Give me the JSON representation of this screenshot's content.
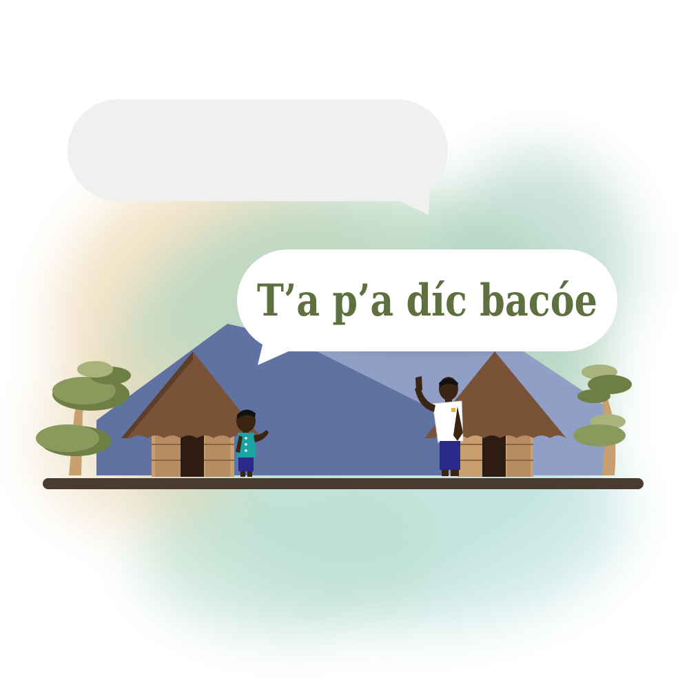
{
  "speech": {
    "upper_bubble_text": "",
    "lower_bubble_text": "T’a p’a díc bacóe"
  },
  "colors": {
    "text_green": "#5f7040",
    "bubble_upper": "#f0f0f0",
    "bubble_lower": "#ffffff",
    "mountain_back": "#8f9fc6",
    "mountain_front": "#5f72a2",
    "roof": "#7a5238",
    "hut_wall": "#c8a070",
    "ground": "#4a3a30",
    "tree_dark": "#6e7f45",
    "tree_light": "#a8b47c"
  },
  "icons": {
    "person_left": "child-figure",
    "person_right": "man-waving-figure",
    "huts": "thatched-hut",
    "trees": "round-tree"
  }
}
